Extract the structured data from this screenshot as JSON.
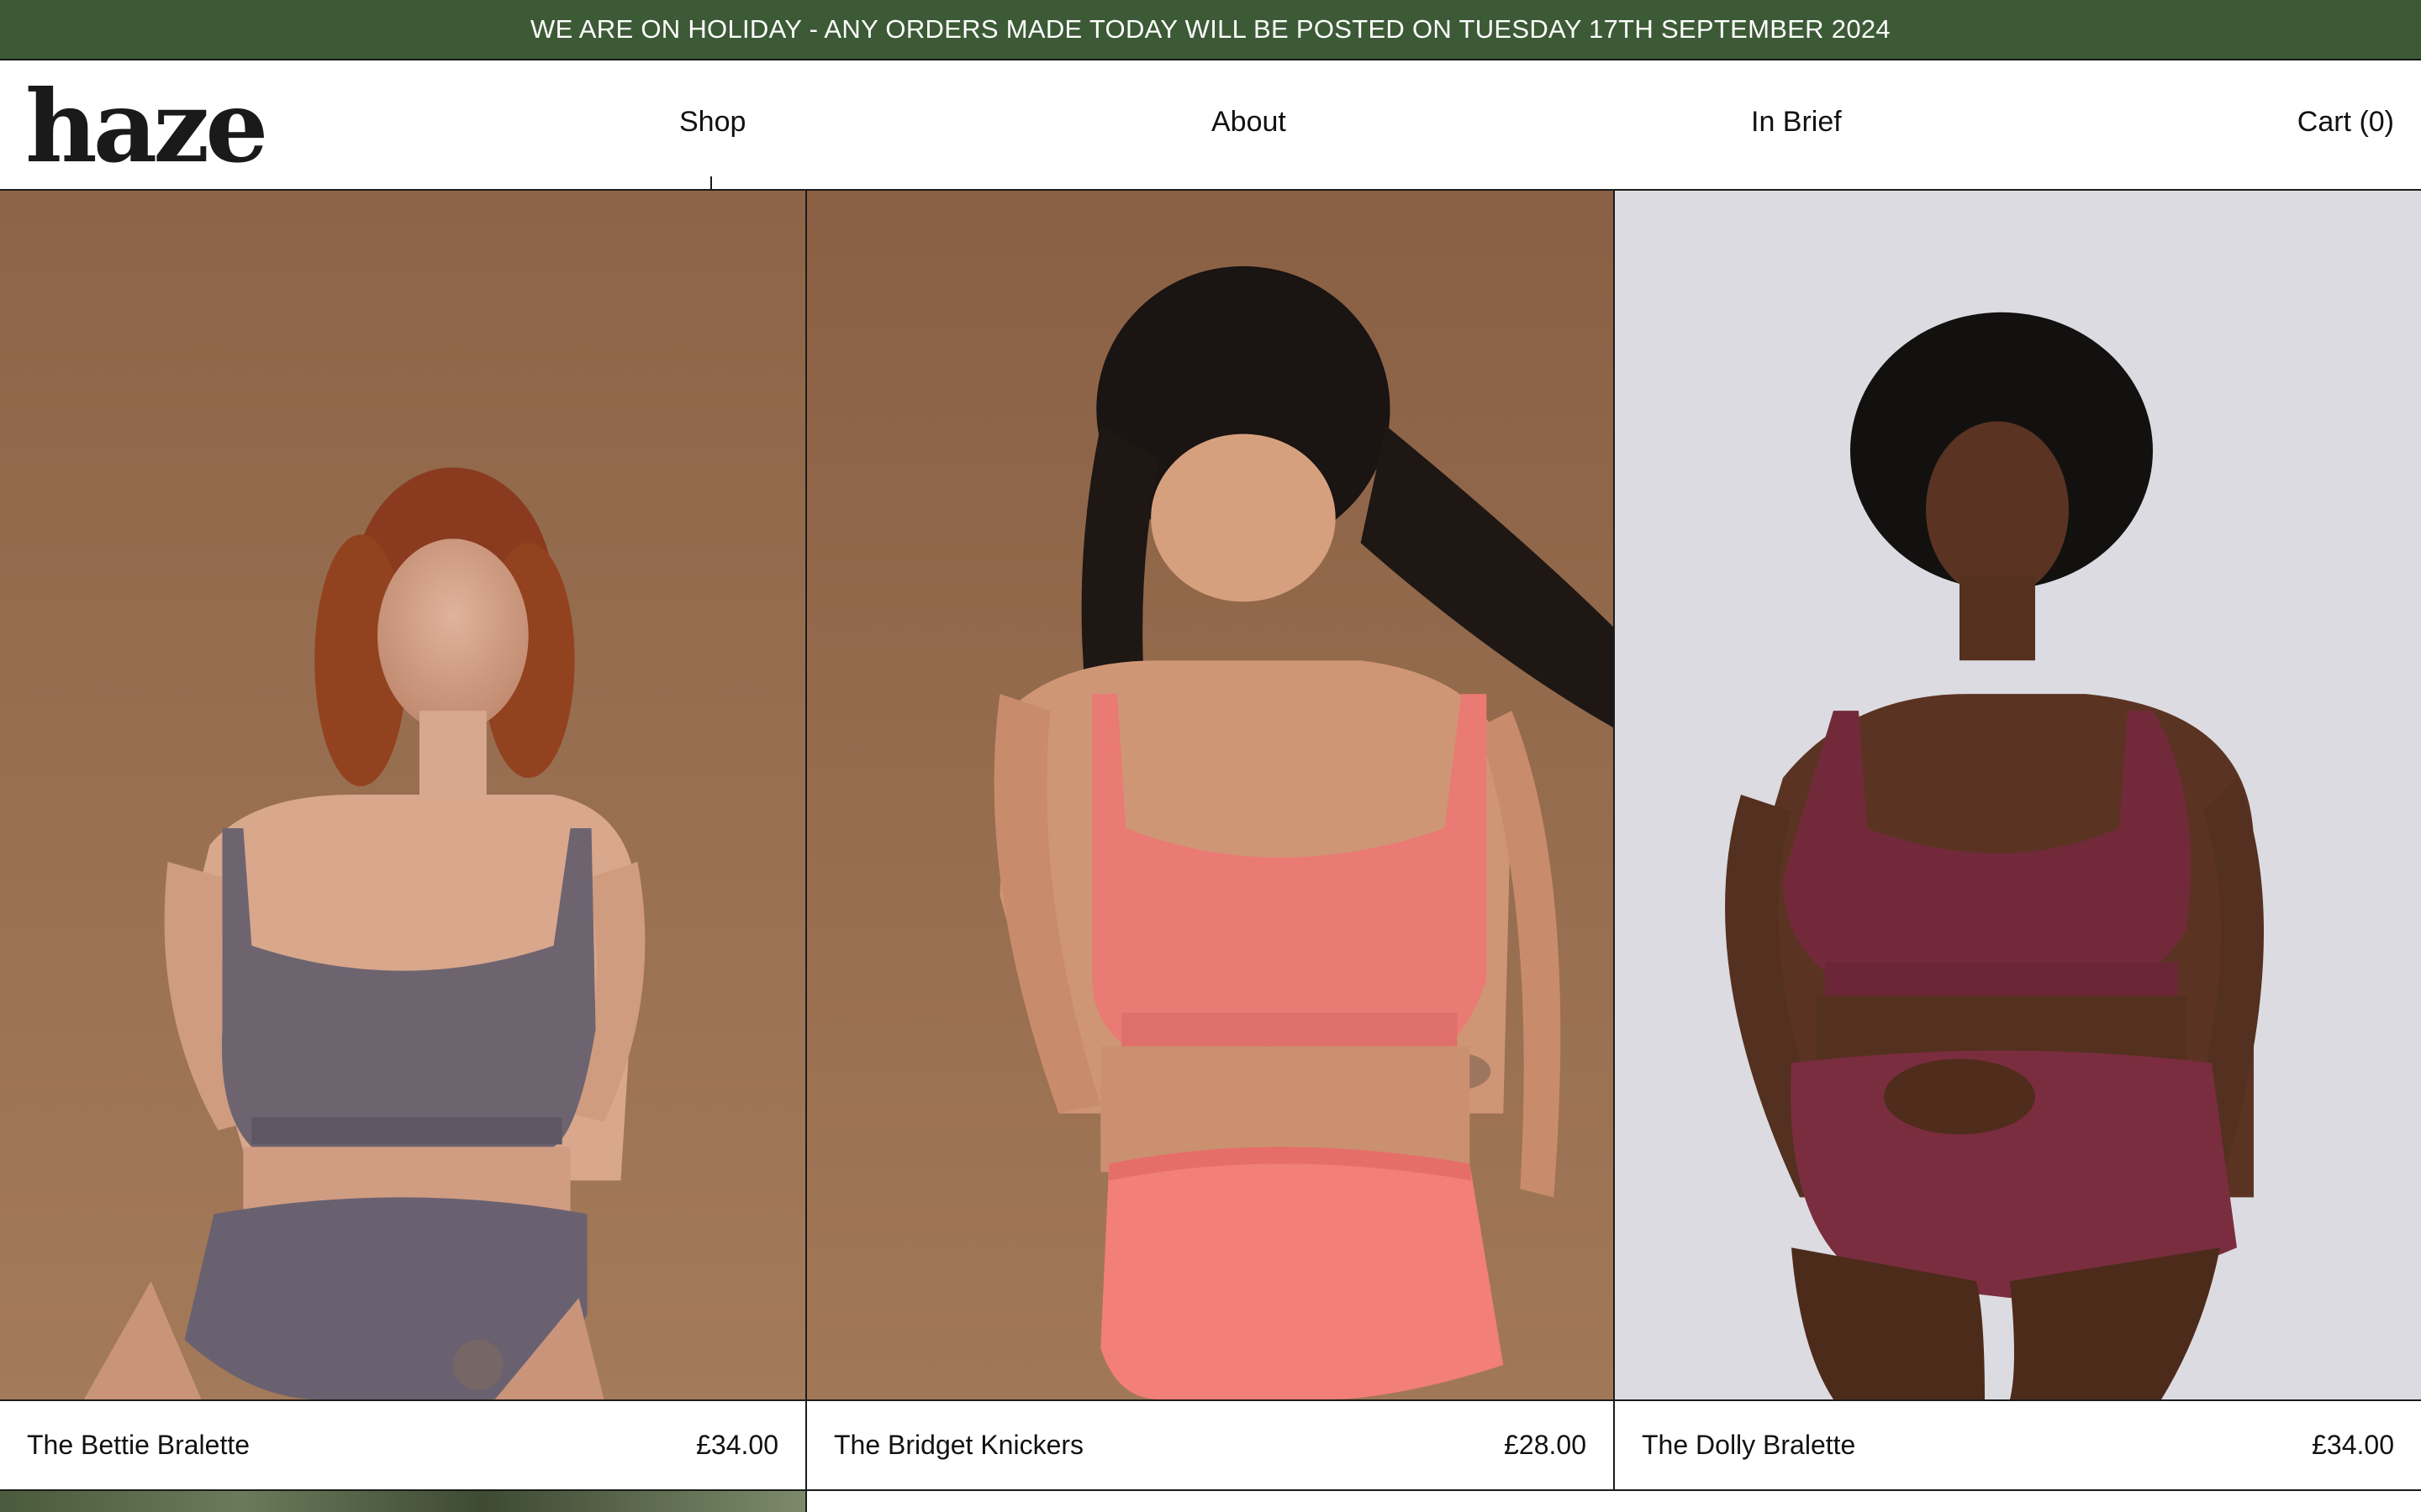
{
  "announcement": "WE ARE ON HOLIDAY - ANY ORDERS MADE TODAY WILL BE POSTED ON TUESDAY 17TH SEPTEMBER 2024",
  "header": {
    "logo": "haze",
    "nav": {
      "shop": "Shop",
      "about": "About",
      "in_brief": "In Brief",
      "cart": "Cart (0)"
    }
  },
  "products": [
    {
      "name": "The Bettie Bralette",
      "price": "£34.00",
      "colorway": "#6e6470"
    },
    {
      "name": "The Bridget Knickers",
      "price": "£28.00",
      "colorway": "#ea7a74"
    },
    {
      "name": "The Dolly Bralette",
      "price": "£34.00",
      "colorway": "#722a3b"
    }
  ],
  "colors": {
    "announcement_bg": "#3c5a36",
    "announcement_text": "#ffffff",
    "border": "#1b1b1b",
    "backdrop_warm": "#9a6e4e",
    "backdrop_grey": "#dcdbe1"
  },
  "icons": {
    "active_nav_indicator": "tick-mark"
  }
}
